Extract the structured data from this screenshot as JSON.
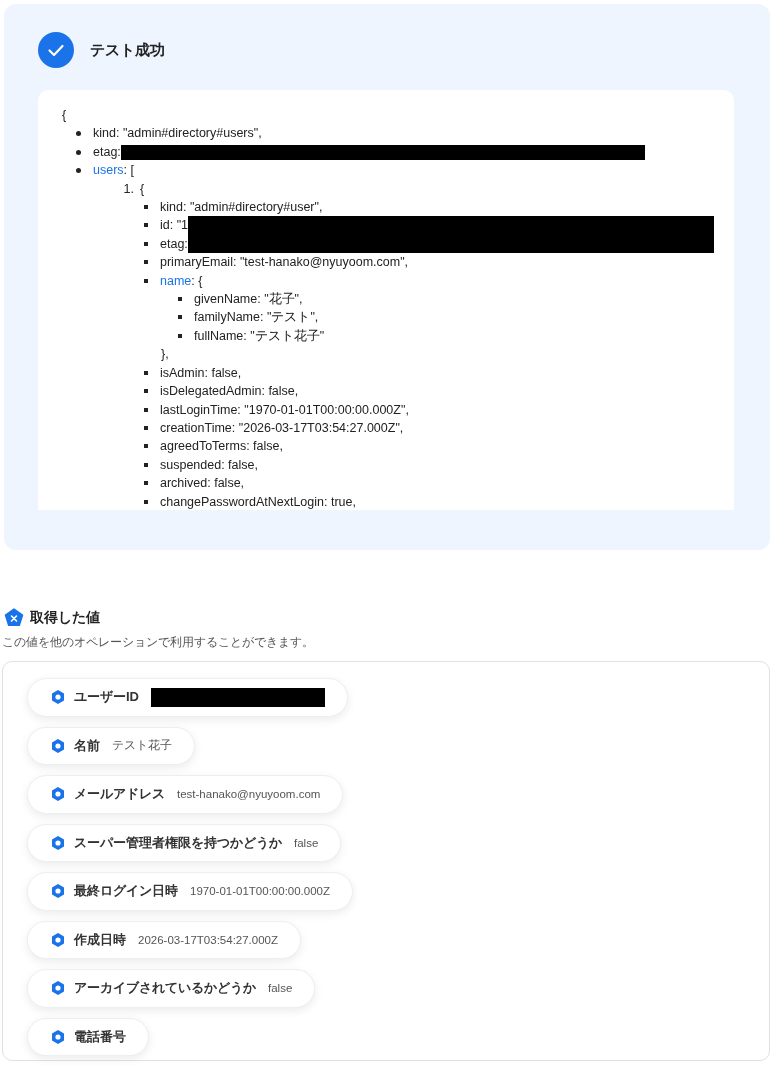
{
  "result": {
    "status": "テスト成功",
    "open": "{",
    "items": [
      {
        "key": "kind",
        "link": false,
        "rest": ": \"admin#directory#users\","
      },
      {
        "key": "etag",
        "link": false,
        "rest": ": ",
        "redacted": true
      },
      {
        "key": "users",
        "link": true,
        "rest": ": [",
        "entries": [
          {
            "number": "1.",
            "open": "{",
            "items": [
              {
                "key": "kind",
                "link": false,
                "rest": ": \"admin#directory#user\","
              },
              {
                "key": "id",
                "link": false,
                "rest": ": \"1",
                "redacted": true
              },
              {
                "key": "etag",
                "link": false,
                "rest": ":",
                "redacted": true
              },
              {
                "key": "primaryEmail",
                "link": false,
                "rest": ": \"test-hanako@nyuyoom.com\","
              },
              {
                "key": "name",
                "link": true,
                "rest": ": {",
                "close": "},",
                "items": [
                  {
                    "key": "givenName",
                    "link": false,
                    "rest": ": \"花子\","
                  },
                  {
                    "key": "familyName",
                    "link": false,
                    "rest": ": \"テスト\","
                  },
                  {
                    "key": "fullName",
                    "link": false,
                    "rest": ": \"テスト花子\""
                  }
                ]
              },
              {
                "key": "isAdmin",
                "link": false,
                "rest": ": false,"
              },
              {
                "key": "isDelegatedAdmin",
                "link": false,
                "rest": ": false,"
              },
              {
                "key": "lastLoginTime",
                "link": false,
                "rest": ": \"1970-01-01T00:00:00.000Z\","
              },
              {
                "key": "creationTime",
                "link": false,
                "rest": ": \"2026-03-17T03:54:27.000Z\","
              },
              {
                "key": "agreedToTerms",
                "link": false,
                "rest": ": false,"
              },
              {
                "key": "suspended",
                "link": false,
                "rest": ": false,"
              },
              {
                "key": "archived",
                "link": false,
                "rest": ": false,"
              },
              {
                "key": "changePasswordAtNextLogin",
                "link": false,
                "rest": ": true,"
              }
            ]
          }
        ]
      }
    ]
  },
  "outputs": {
    "title": "取得した値",
    "description": "この値を他のオペレーションで利用することができます。",
    "fields": [
      {
        "label": "ユーザーID",
        "redacted": true
      },
      {
        "label": "名前",
        "value": "テスト花子"
      },
      {
        "label": "メールアドレス",
        "value": "test-hanako@nyuyoom.com"
      },
      {
        "label": "スーパー管理者権限を持つかどうか",
        "value": "false"
      },
      {
        "label": "最終ログイン日時",
        "value": "1970-01-01T00:00:00.000Z"
      },
      {
        "label": "作成日時",
        "value": "2026-03-17T03:54:27.000Z"
      },
      {
        "label": "アーカイブされているかどうか",
        "value": "false"
      },
      {
        "label": "電話番号"
      }
    ]
  }
}
